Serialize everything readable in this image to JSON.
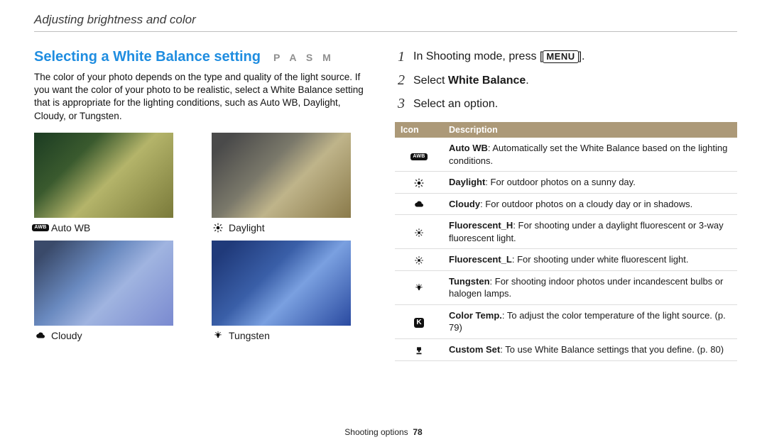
{
  "breadcrumb": "Adjusting brightness and color",
  "left": {
    "heading": "Selecting a White Balance setting",
    "modes": "P A S M",
    "body": "The color of your photo depends on the type and quality of the light source. If you want the color of your photo to be realistic, select a White Balance setting that is appropriate for the lighting conditions, such as Auto WB, Daylight, Cloudy, or Tungsten.",
    "thumbs": [
      {
        "label": "Auto WB",
        "icon": "auto-wb-icon"
      },
      {
        "label": "Daylight",
        "icon": "daylight-icon"
      },
      {
        "label": "Cloudy",
        "icon": "cloudy-icon"
      },
      {
        "label": "Tungsten",
        "icon": "tungsten-icon"
      }
    ]
  },
  "right": {
    "steps": {
      "s1_pre": "In Shooting mode, press [",
      "s1_chip": "MENU",
      "s1_post": "].",
      "s2_pre": "Select ",
      "s2_bold": "White Balance",
      "s2_post": ".",
      "s3": "Select an option."
    },
    "table": {
      "head_icon": "Icon",
      "head_desc": "Description",
      "rows": [
        {
          "icon": "auto-wb-icon",
          "name": "Auto WB",
          "desc": ": Automatically set the White Balance based on the lighting conditions."
        },
        {
          "icon": "daylight-icon",
          "name": "Daylight",
          "desc": ": For outdoor photos on a sunny day."
        },
        {
          "icon": "cloudy-icon",
          "name": "Cloudy",
          "desc": ": For outdoor photos on a cloudy day or in shadows."
        },
        {
          "icon": "fluorescent-h-icon",
          "name": "Fluorescent_H",
          "desc": ": For shooting under a daylight fluorescent or 3-way fluorescent light."
        },
        {
          "icon": "fluorescent-l-icon",
          "name": "Fluorescent_L",
          "desc": ": For shooting under white fluorescent light."
        },
        {
          "icon": "tungsten-icon",
          "name": "Tungsten",
          "desc": ": For shooting indoor photos under incandescent bulbs or halogen lamps."
        },
        {
          "icon": "color-temp-icon",
          "name": "Color Temp.",
          "desc": ": To adjust the color temperature of the light source. (p. 79)"
        },
        {
          "icon": "custom-set-icon",
          "name": "Custom Set",
          "desc": ": To use White Balance settings that you define. (p. 80)"
        }
      ]
    }
  },
  "footer": {
    "section": "Shooting options",
    "page": "78"
  }
}
